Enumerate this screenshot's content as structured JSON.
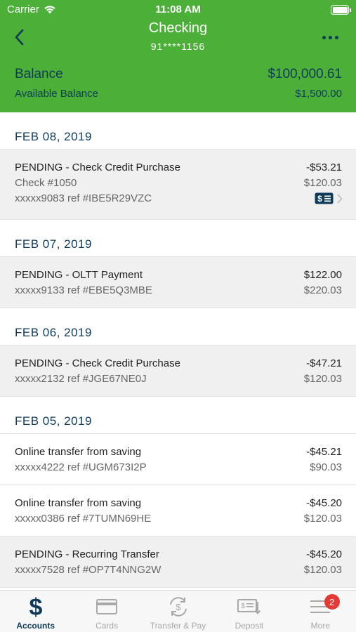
{
  "status_bar": {
    "carrier": "Carrier",
    "time": "11:08 AM"
  },
  "nav": {
    "title": "Checking",
    "account_mask": "91****1156",
    "back_icon": "chevron-left-icon",
    "more_icon": "ellipsis-icon"
  },
  "balance": {
    "label": "Balance",
    "value": "$100,000.61",
    "available_label": "Available Balance",
    "available_value": "$1,500.00"
  },
  "groups": [
    {
      "date": "FEB 08, 2019"
    },
    {
      "date": "FEB 07, 2019"
    },
    {
      "date": "FEB 06, 2019"
    },
    {
      "date": "FEB 05, 2019"
    }
  ],
  "transactions": [
    {
      "desc": "PENDING - Check Credit Purchase",
      "check": "Check #1050",
      "ref": "xxxxx9083 ref #IBE5R29VZC",
      "amount": "-$53.21",
      "balance": "$120.03"
    },
    {
      "desc": "PENDING - OLTT Payment",
      "ref": "xxxxx9133 ref #EBE5Q3MBE",
      "amount": "$122.00",
      "balance": "$220.03"
    },
    {
      "desc": "PENDING - Check Credit Purchase",
      "ref": "xxxxx2132 ref #JGE67NE0J",
      "amount": "-$47.21",
      "balance": "$120.03"
    },
    {
      "desc": "Online transfer from saving",
      "ref": "xxxxx4222 ref #UGM673I2P",
      "amount": "-$45.21",
      "balance": "$90.03"
    },
    {
      "desc": "Online transfer from saving",
      "ref": "xxxxx0386 ref #7TUMN69HE",
      "amount": "-$45.20",
      "balance": "$120.03"
    },
    {
      "desc": "PENDING - Recurring Transfer",
      "ref": "xxxxx7528 ref #OP7T4NNG2W",
      "amount": "-$45.20",
      "balance": "$120.03"
    }
  ],
  "tabs": [
    {
      "label": "Accounts",
      "icon": "dollar-icon",
      "active": true
    },
    {
      "label": "Cards",
      "icon": "card-icon"
    },
    {
      "label": "Transfer & Pay",
      "icon": "transfer-icon"
    },
    {
      "label": "Deposit",
      "icon": "deposit-check-icon"
    },
    {
      "label": "More",
      "icon": "menu-icon",
      "badge": "2"
    }
  ],
  "colors": {
    "brand_green": "#4caf38",
    "navy": "#0f3a58",
    "badge_red": "#e53935"
  }
}
